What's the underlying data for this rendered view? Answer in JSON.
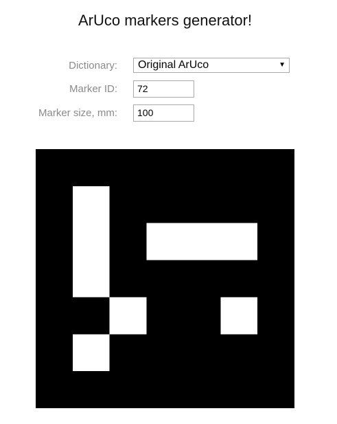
{
  "page": {
    "title": "ArUco markers generator!"
  },
  "form": {
    "dictionary": {
      "label": "Dictionary:",
      "value": "Original ArUco"
    },
    "marker_id": {
      "label": "Marker ID:",
      "value": "72"
    },
    "marker_size": {
      "label": "Marker size, mm:",
      "value": "100"
    }
  },
  "marker": {
    "grid_size": 7,
    "foreground_color": "#000000",
    "background_color": "#ffffff",
    "bits": [
      [
        0,
        0,
        0,
        0,
        0,
        0,
        0
      ],
      [
        0,
        1,
        0,
        0,
        0,
        0,
        0
      ],
      [
        0,
        1,
        0,
        1,
        1,
        1,
        0
      ],
      [
        0,
        1,
        0,
        0,
        0,
        0,
        0
      ],
      [
        0,
        0,
        1,
        0,
        0,
        1,
        0
      ],
      [
        0,
        1,
        0,
        0,
        0,
        0,
        0
      ],
      [
        0,
        0,
        0,
        0,
        0,
        0,
        0
      ]
    ]
  }
}
